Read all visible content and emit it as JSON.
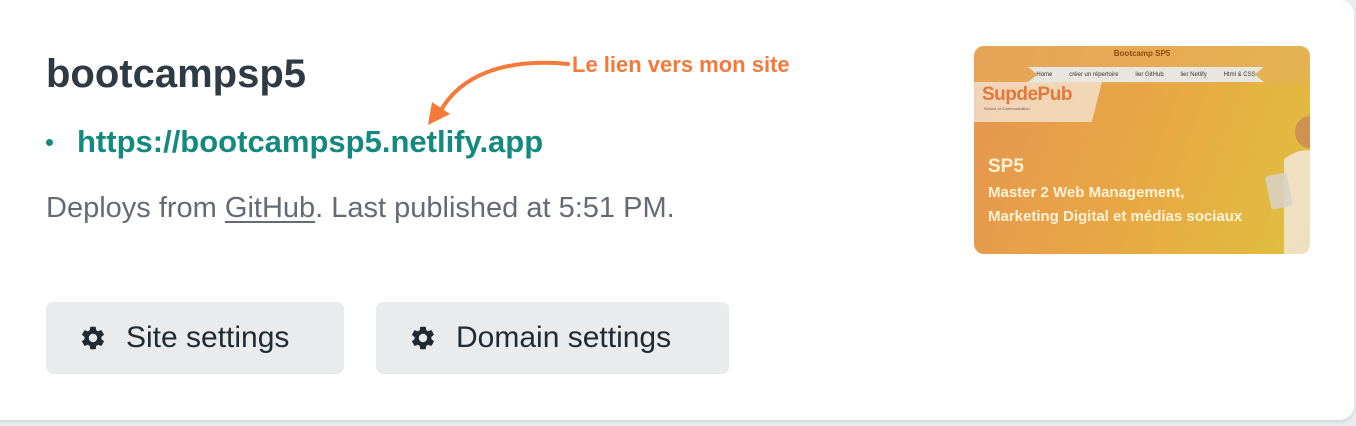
{
  "site": {
    "name": "bootcampsp5",
    "url": "https://bootcampsp5.netlify.app",
    "deploy_prefix": "Deploys from ",
    "deploy_source": "GitHub",
    "deploy_suffix": ". Last published at 5:51 PM."
  },
  "annotation": {
    "text": "Le lien vers mon site",
    "color": "#f5793a"
  },
  "buttons": {
    "site_settings": {
      "label": "Site settings",
      "icon": "gear-icon"
    },
    "domain_settings": {
      "label": "Domain settings",
      "icon": "gear-icon"
    }
  },
  "thumbnail": {
    "header_title": "Bootcamp SP5",
    "nav": [
      "Home",
      "créer un répertoire",
      "lier GitHub",
      "lier Netlify",
      "Html & CSS"
    ],
    "logo": "SupdePub",
    "logo_sub": "School of Communication",
    "heading": "SP5",
    "line1": "Master 2 Web Management,",
    "line2": "Marketing Digital et médias sociaux"
  },
  "colors": {
    "link": "#148a7e",
    "title": "#2e3a44",
    "muted": "#646b73",
    "button_bg": "#e9ebed"
  }
}
